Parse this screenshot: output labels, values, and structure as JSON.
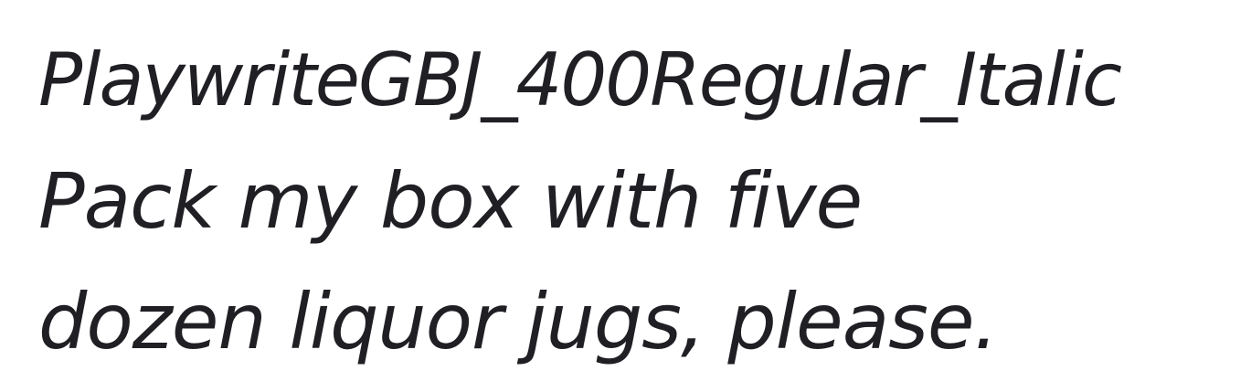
{
  "specimen": {
    "title": "PlaywriteGBJ_400Regular_Italic",
    "sample_line_1": "Pack my box with five",
    "sample_line_2": "dozen liquor jugs, please."
  },
  "colors": {
    "background": "#ffffff",
    "text": "#1f1f24"
  }
}
